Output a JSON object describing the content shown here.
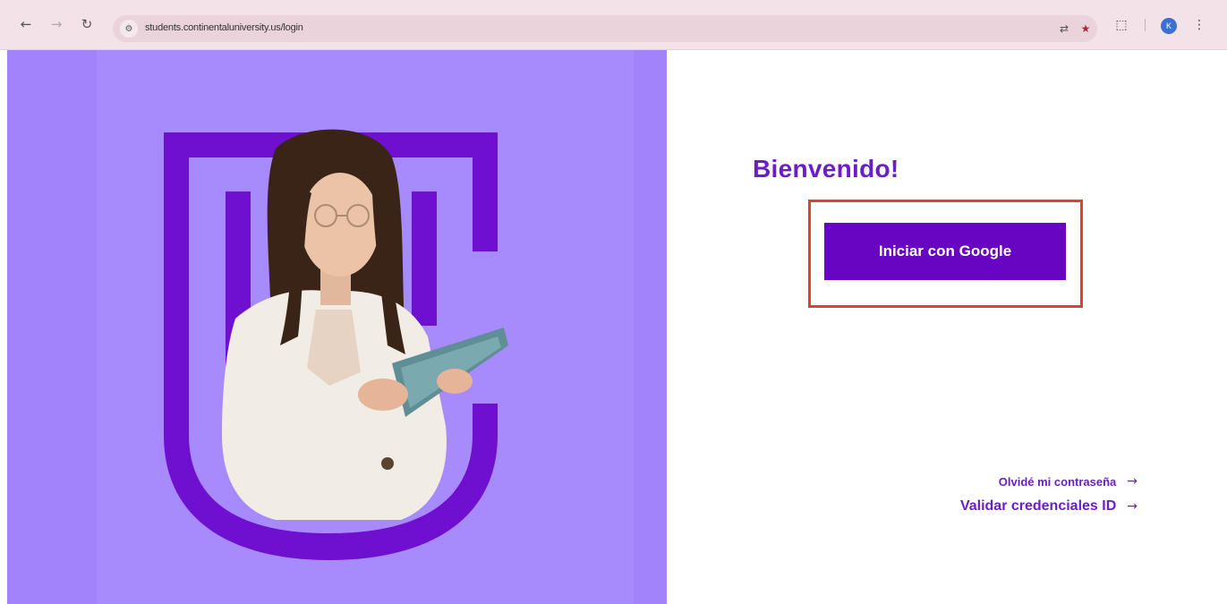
{
  "browser": {
    "url": "students.continentaluniversity.us/login",
    "icons": {
      "back": "arrow-left-icon",
      "forward": "arrow-right-icon",
      "reload": "reload-icon",
      "site_info": "tune-icon",
      "translate": "translate-icon",
      "bookmark": "star-icon",
      "extensions": "puzzle-icon",
      "menu": "kebab-menu-icon"
    },
    "avatar_letter": "K",
    "colors": {
      "toolbar": "#f3e3e8",
      "omnibox": "#ead3da",
      "bookmark_star": "#b2233b"
    }
  },
  "login": {
    "welcome_title": "Bienvenido!",
    "google_button_label": "Iniciar con Google",
    "forgot_password_link": "Olvidé mi contraseña",
    "validate_credentials_link": "Validar credenciales ID",
    "link_arrow": "→"
  },
  "colors": {
    "hero_background": "#a383fb",
    "brand_purple": "#6805c2",
    "title_purple": "#6a1fc6",
    "highlight_red": "#e23c3c"
  }
}
